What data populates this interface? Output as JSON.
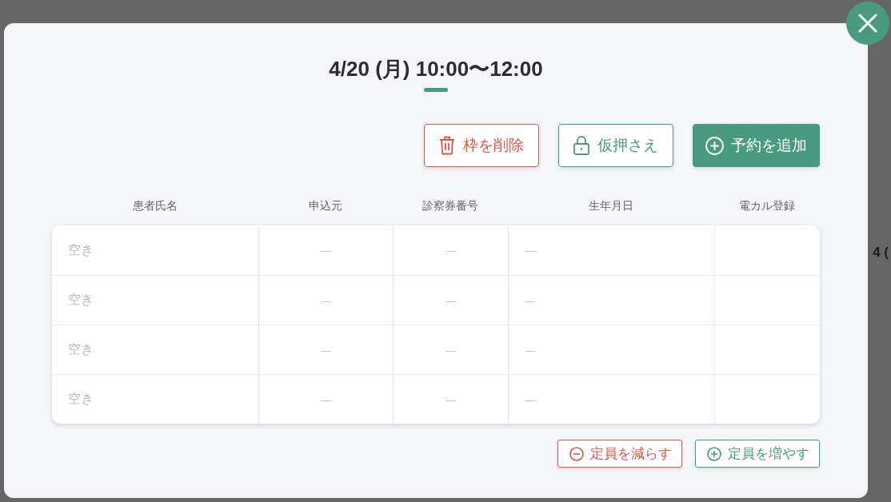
{
  "background_page": {
    "partial_text": "4 ("
  },
  "dialog": {
    "title": "4/20 (月) 10:00〜12:00",
    "actions": [
      {
        "label": "枠を削除",
        "kind": "danger"
      },
      {
        "label": "仮押さえ",
        "kind": "secondary"
      },
      {
        "label": "予約を追加",
        "kind": "primary"
      }
    ],
    "table": {
      "columns": [
        "患者氏名",
        "申込元",
        "診察券番号",
        "生年月日",
        "電カル登録"
      ],
      "rows": [
        {
          "cells": [
            "空き",
            "—",
            "—",
            "—"
          ]
        },
        {
          "cells": [
            "空き",
            "—",
            "—",
            "—"
          ]
        },
        {
          "cells": [
            "空き",
            "—",
            "—",
            "—"
          ]
        },
        {
          "cells": [
            "空き",
            "—",
            "—",
            "—"
          ]
        }
      ]
    },
    "capacity_buttons": [
      {
        "label": "定員を減らす",
        "kind": "decrease"
      },
      {
        "label": "定員を増やす",
        "kind": "increase"
      }
    ]
  }
}
